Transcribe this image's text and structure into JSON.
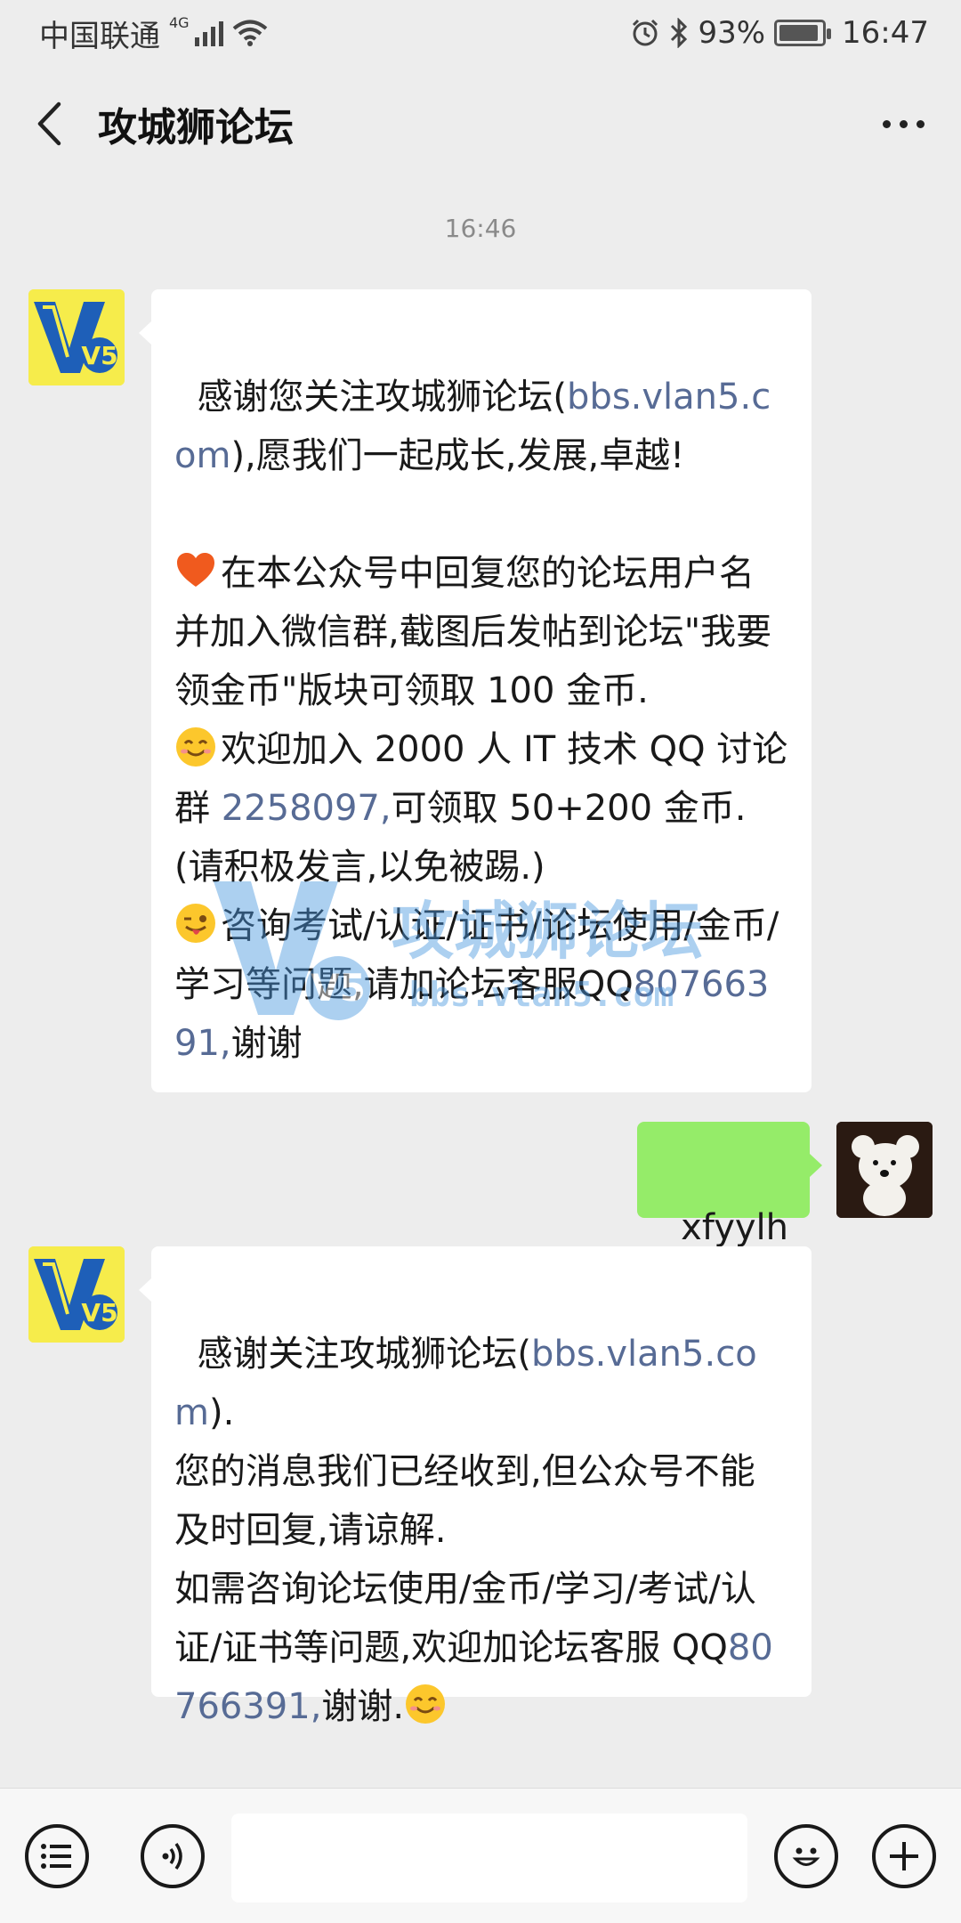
{
  "status_bar": {
    "carrier": "中国联通",
    "network_type": "4G",
    "battery_percent": "93%",
    "battery_level": 0.93,
    "time": "16:47"
  },
  "header": {
    "title": "攻城狮论坛"
  },
  "chat": {
    "timestamp": "16:46",
    "messages": [
      {
        "from": "account",
        "p1_a": "感谢您关注攻城狮论坛(",
        "p1_link": "bbs.vlan5.com",
        "p1_b": "),愿我们一起成长,发展,卓越!",
        "p2": "在本公众号中回复您的论坛用户名并加入微信群,截图后发帖到论坛\"我要领金币\"版块可领取 100 金币.",
        "p3_a": "欢迎加入 2000 人 IT 技术 QQ 讨论群 ",
        "p3_link": "2258097,",
        "p3_b": "可领取 50+200 金币.(请积极发言,以免被踢.)",
        "p4_a": "咨询考试/认证/证书/论坛使用/金币/学习等问题,请加论坛客服QQ",
        "p4_link": "80766391,",
        "p4_b": "谢谢"
      },
      {
        "from": "me",
        "text": "xfyylh"
      },
      {
        "from": "account",
        "p1_a": "感谢关注攻城狮论坛(",
        "p1_link": "bbs.vlan5.com",
        "p1_b": ").",
        "p2": "您的消息我们已经收到,但公众号不能及时回复,请谅解.",
        "p3_a": "如需咨询论坛使用/金币/学习/考试/认证/证书等问题,欢迎加论坛客服 QQ",
        "p3_link": "80766391,",
        "p3_b": "谢谢."
      }
    ],
    "watermark": {
      "brand": "攻城狮论坛",
      "url": "bbs.vlan5.com",
      "logo_text": "V5"
    },
    "avatar_logo_text": "V5"
  },
  "icons": {
    "menu": "list-menu-icon",
    "voice": "voice-icon",
    "emoji": "emoji-icon",
    "add": "plus-icon"
  },
  "colors": {
    "link": "#576b95",
    "outgoing_bubble": "#95ec69",
    "background": "#ededed"
  }
}
